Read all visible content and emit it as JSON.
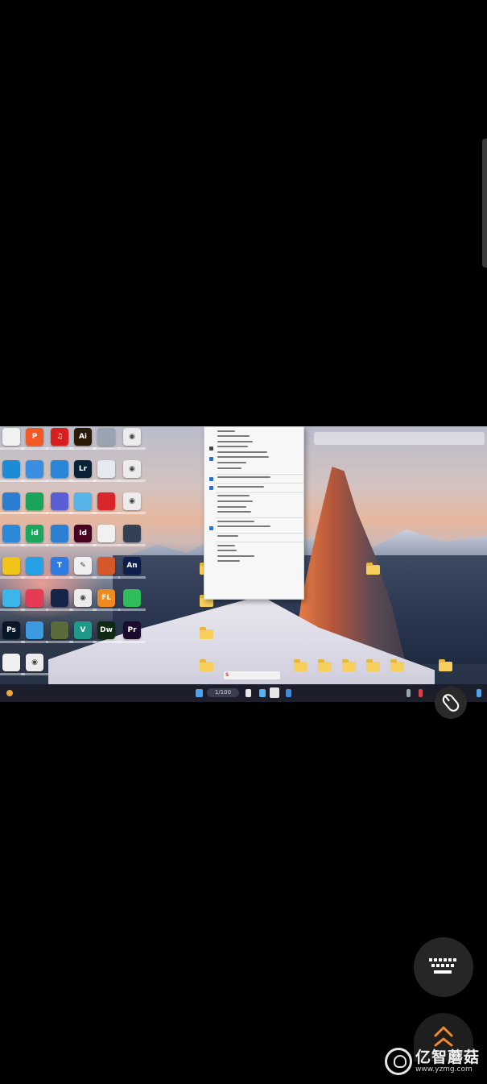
{
  "desktop": {
    "icons": [
      {
        "name": "shortcut-icon",
        "label": "",
        "color": "#f1f1f1",
        "glyph": ""
      },
      {
        "name": "pdf-app-icon",
        "label": "",
        "color": "#f15a24",
        "glyph": "P"
      },
      {
        "name": "netease-music-icon",
        "label": "",
        "color": "#d91e1e",
        "glyph": "♫"
      },
      {
        "name": "illustrator-icon",
        "label": "",
        "color": "#2b1a06",
        "glyph": "Ai"
      },
      {
        "name": "folder-window-icon",
        "label": "",
        "color": "#9aa3b0",
        "glyph": ""
      },
      {
        "name": "disc-icon",
        "label": "",
        "color": "#ececec",
        "glyph": "◉"
      },
      {
        "name": "edge-icon",
        "label": "",
        "color": "#1e8bd6",
        "glyph": ""
      },
      {
        "name": "chrome-icon",
        "label": "",
        "color": "#3b8fe0",
        "glyph": ""
      },
      {
        "name": "photos-icon",
        "label": "",
        "color": "#2a87d8",
        "glyph": ""
      },
      {
        "name": "lightroom-icon",
        "label": "",
        "color": "#0a2238",
        "glyph": "Lr"
      },
      {
        "name": "document-icon",
        "label": "",
        "color": "#e5e9f0",
        "glyph": ""
      },
      {
        "name": "disc-icon",
        "label": "",
        "color": "#ececec",
        "glyph": "◉"
      },
      {
        "name": "folder-icon",
        "label": "",
        "color": "#2c7fd0",
        "glyph": ""
      },
      {
        "name": "wechat-work-icon",
        "label": "",
        "color": "#19a35b",
        "glyph": ""
      },
      {
        "name": "sync-icon",
        "label": "",
        "color": "#5b5fd6",
        "glyph": ""
      },
      {
        "name": "network-icon",
        "label": "",
        "color": "#58b4e8",
        "glyph": ""
      },
      {
        "name": "red-app-icon",
        "label": "",
        "color": "#d8262c",
        "glyph": ""
      },
      {
        "name": "disc-icon",
        "label": "",
        "color": "#ececec",
        "glyph": "◉"
      },
      {
        "name": "browser-icon",
        "label": "",
        "color": "#2d8ad8",
        "glyph": ""
      },
      {
        "name": "idea-icon",
        "label": "",
        "color": "#1aa85e",
        "glyph": "id"
      },
      {
        "name": "blue-doc-icon",
        "label": "",
        "color": "#2d7fd3",
        "glyph": ""
      },
      {
        "name": "indesign-icon",
        "label": "",
        "color": "#49021f",
        "glyph": "Id"
      },
      {
        "name": "file-icon",
        "label": "",
        "color": "#f1f1f1",
        "glyph": ""
      },
      {
        "name": "terminal-icon",
        "label": "",
        "color": "#344054",
        "glyph": ""
      },
      {
        "name": "qq-icon",
        "label": "",
        "color": "#f0c419",
        "glyph": ""
      },
      {
        "name": "app-icon",
        "label": "",
        "color": "#27a0e6",
        "glyph": ""
      },
      {
        "name": "teams-icon",
        "label": "",
        "color": "#2e7ce0",
        "glyph": "T"
      },
      {
        "name": "pen-icon",
        "label": "",
        "color": "#f0f0f0",
        "glyph": "✎"
      },
      {
        "name": "ppt-icon",
        "label": "",
        "color": "#d4582a",
        "glyph": ""
      },
      {
        "name": "animate-icon",
        "label": "",
        "color": "#0d1f4a",
        "glyph": "An"
      },
      {
        "name": "folder-blue-icon",
        "label": "",
        "color": "#3cb6e8",
        "glyph": ""
      },
      {
        "name": "media-icon",
        "label": "",
        "color": "#e63b57",
        "glyph": ""
      },
      {
        "name": "steam-icon",
        "label": "",
        "color": "#16244a",
        "glyph": ""
      },
      {
        "name": "disc-icon",
        "label": "",
        "color": "#ececec",
        "glyph": "◉"
      },
      {
        "name": "fl-studio-icon",
        "label": "",
        "color": "#f08a1e",
        "glyph": "FL"
      },
      {
        "name": "wechat-icon",
        "label": "",
        "color": "#2fbd5b",
        "glyph": ""
      },
      {
        "name": "photoshop-icon",
        "label": "",
        "color": "#07182b",
        "glyph": "Ps"
      },
      {
        "name": "cloud-icon",
        "label": "",
        "color": "#3c9ae0",
        "glyph": ""
      },
      {
        "name": "book-icon",
        "label": "",
        "color": "#5a6b3a",
        "glyph": ""
      },
      {
        "name": "vs-icon",
        "label": "",
        "color": "#1f9a8a",
        "glyph": "V"
      },
      {
        "name": "dreamweaver-icon",
        "label": "",
        "color": "#0e2a12",
        "glyph": "Dw"
      },
      {
        "name": "premiere-icon",
        "label": "",
        "color": "#1c0a2e",
        "glyph": "Pr"
      },
      {
        "name": "text-doc-icon",
        "label": "",
        "color": "#f0f0f0",
        "glyph": ""
      },
      {
        "name": "disc-icon",
        "label": "",
        "color": "#ececec",
        "glyph": "◉"
      }
    ]
  },
  "context_menu": {
    "items": [
      "",
      "",
      "",
      "",
      "",
      "",
      "",
      "",
      "",
      "",
      "",
      "",
      "",
      "",
      "",
      "",
      "",
      "",
      "",
      "",
      "",
      "",
      "",
      "",
      "",
      "",
      ""
    ]
  },
  "taskbar": {
    "search_text": "1/100"
  },
  "banner": {
    "text": "S"
  },
  "overlay": {
    "mouse_icon": "mouse-icon",
    "keyboard_icon": "keyboard-icon",
    "expand_icon": "chevron-up-icon"
  },
  "watermark": {
    "brand": "亿智蘑菇",
    "url": "www.yzmg.com"
  }
}
